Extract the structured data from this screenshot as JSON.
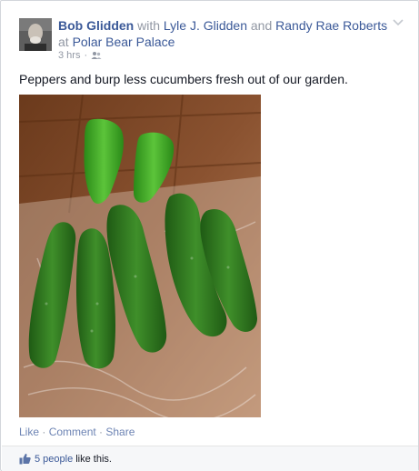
{
  "post": {
    "author": "Bob Glidden",
    "with_word": "with",
    "tagged_1": "Lyle J. Glidden",
    "and_word": "and",
    "tagged_2": "Randy Rae Roberts",
    "at_word": "at",
    "location": "Polar Bear Palace",
    "timestamp": "3 hrs",
    "separator": "·",
    "audience_icon": "friends-icon",
    "menu_icon": "chevron-down-icon",
    "text": "Peppers and burp less cucumbers fresh out of our garden."
  },
  "actions": {
    "like": "Like",
    "comment": "Comment",
    "share": "Share",
    "separator": " · "
  },
  "likes": {
    "icon": "thumbs-up-icon",
    "count_text": "5 people",
    "suffix": "like this."
  },
  "colors": {
    "link": "#3b5998",
    "muted": "#9197a3",
    "action": "#6d84b4",
    "border": "#d3d6db"
  }
}
